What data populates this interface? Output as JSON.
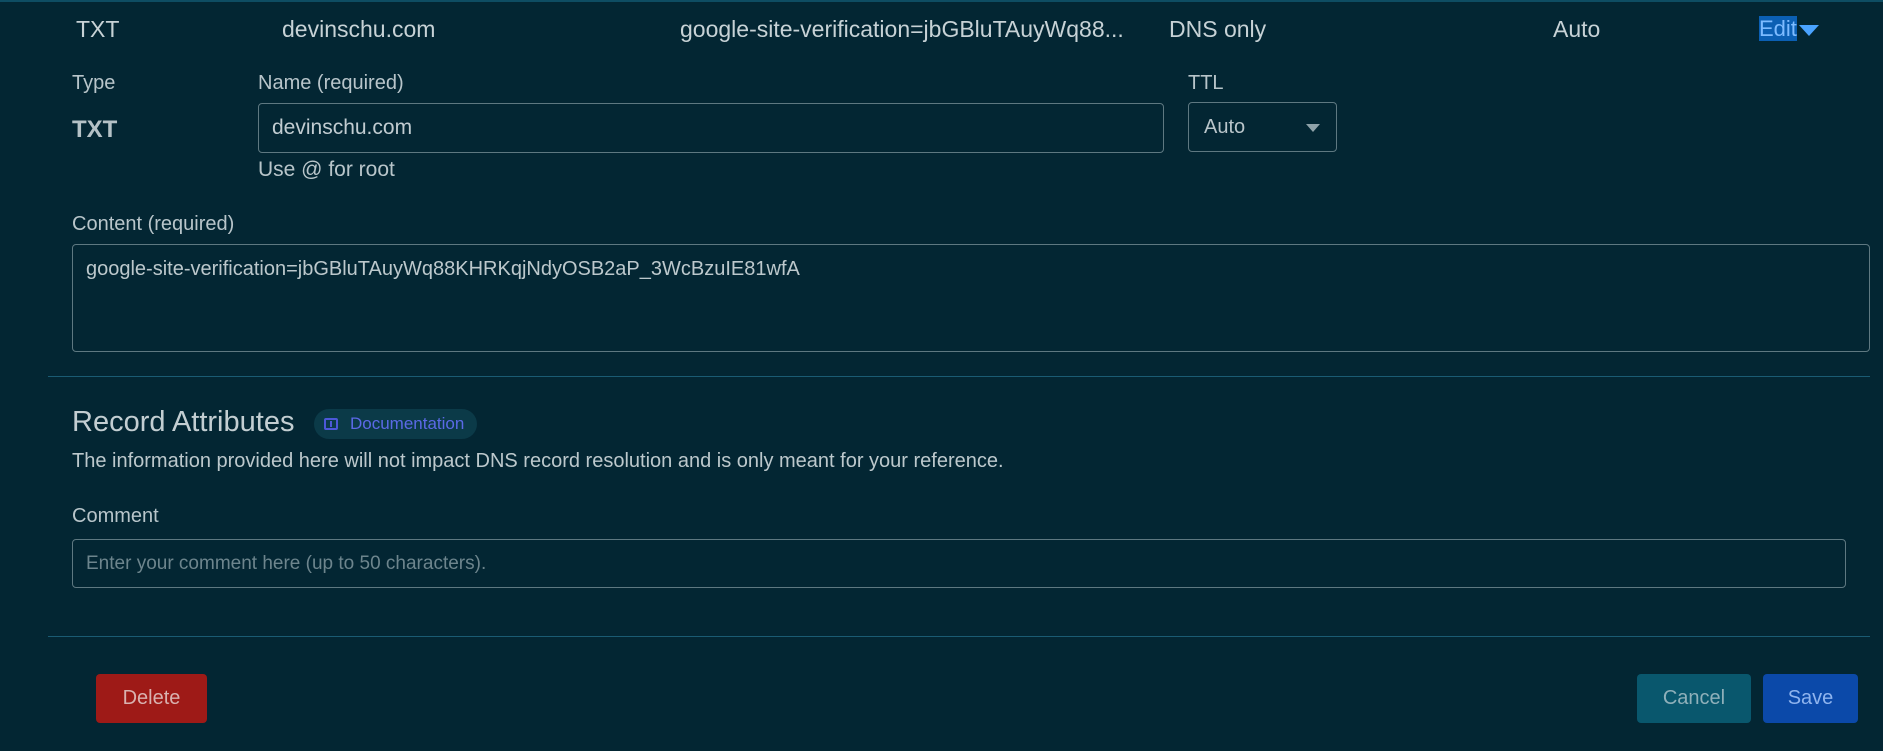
{
  "record_row": {
    "type": "TXT",
    "name": "devinschu.com",
    "content_preview": "google-site-verification=jbGBluTAuyWq88...",
    "proxy_status": "DNS only",
    "ttl": "Auto",
    "edit_label_highlighted": "Edit",
    "edit_label_rest": ""
  },
  "form": {
    "type_label": "Type",
    "type_value": "TXT",
    "name_label": "Name (required)",
    "name_value": "devinschu.com",
    "name_hint": "Use @ for root",
    "ttl_label": "TTL",
    "ttl_value": "Auto",
    "content_label": "Content (required)",
    "content_value": "google-site-verification=jbGBluTAuyWq88KHRKqjNdyOSB2aP_3WcBzuIE81wfA"
  },
  "attributes": {
    "title": "Record Attributes",
    "doc_link": "Documentation",
    "description": "The information provided here will not impact DNS record resolution and is only meant for your reference.",
    "comment_label": "Comment",
    "comment_placeholder": "Enter your comment here (up to 50 characters).",
    "comment_value": ""
  },
  "actions": {
    "delete_label": "Delete",
    "cancel_label": "Cancel",
    "save_label": "Save"
  },
  "colors": {
    "background": "#032633",
    "link": "#5aa9ff",
    "delete": "#9e1a17",
    "cancel": "#09576d",
    "save": "#0b49a9"
  }
}
